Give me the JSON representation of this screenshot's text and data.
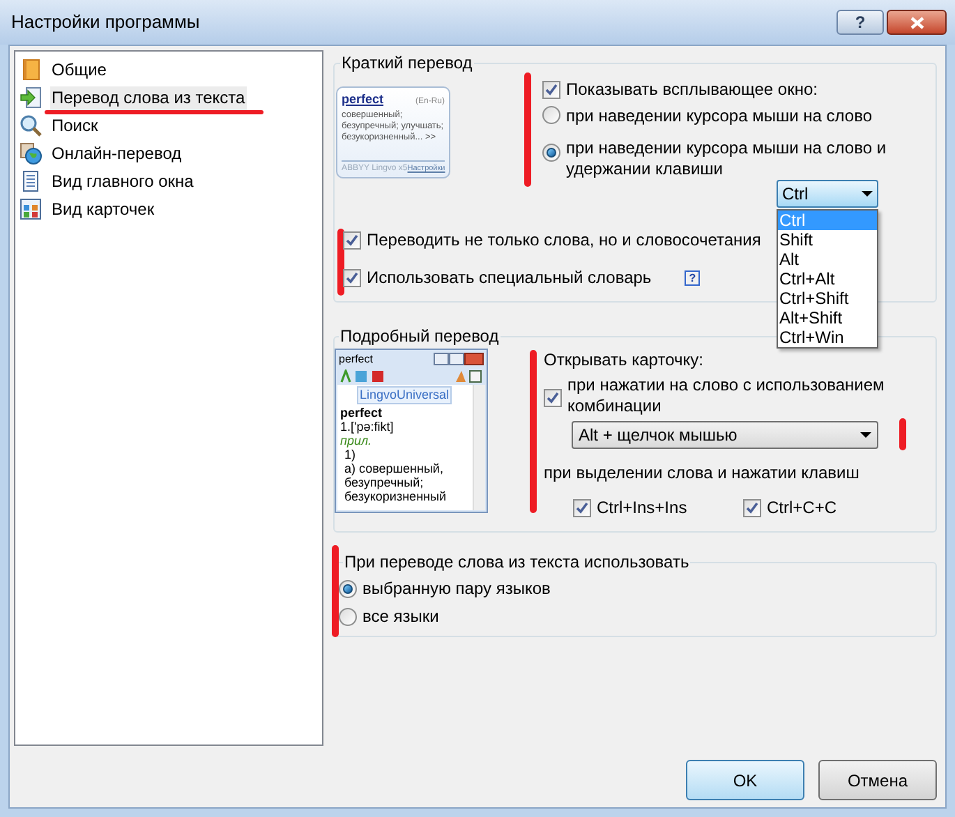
{
  "window": {
    "title": "Настройки программы",
    "help_button": "?"
  },
  "sidebar": {
    "items": [
      {
        "label": "Общие",
        "selected": false
      },
      {
        "label": "Перевод слова из текста",
        "selected": true
      },
      {
        "label": "Поиск",
        "selected": false
      },
      {
        "label": "Онлайн-перевод",
        "selected": false
      },
      {
        "label": "Вид главного окна",
        "selected": false
      },
      {
        "label": "Вид карточек",
        "selected": false
      }
    ]
  },
  "quick_translation": {
    "title": "Краткий перевод",
    "preview": {
      "word": "perfect",
      "langs": "(En-Ru)",
      "lines": [
        "совершенный;",
        "безупречный; улучшать;",
        "безукоризненный... >>"
      ],
      "brand": "ABBYY Lingvo x5",
      "settings_link": "Настройки"
    },
    "show_popup": {
      "label": "Показывать всплывающее окно:",
      "checked": true
    },
    "modes": [
      {
        "label": "при наведении курсора мыши на слово",
        "selected": false
      },
      {
        "label": "при наведении курсора мыши на слово и удержании клавиши",
        "selected": true
      }
    ],
    "key_combo": {
      "value": "Ctrl",
      "expanded": true,
      "options": [
        {
          "label": "Ctrl",
          "selected": true
        },
        {
          "label": "Shift",
          "selected": false
        },
        {
          "label": "Alt",
          "selected": false
        },
        {
          "label": "Ctrl+Alt",
          "selected": false
        },
        {
          "label": "Ctrl+Shift",
          "selected": false
        },
        {
          "label": "Alt+Shift",
          "selected": false
        },
        {
          "label": "Ctrl+Win",
          "selected": false
        }
      ]
    },
    "options": [
      {
        "label": "Переводить не только слова, но и словосочетания",
        "checked": true
      },
      {
        "label": "Использовать специальный словарь",
        "checked": true,
        "help": "?"
      }
    ]
  },
  "detailed_translation": {
    "title": "Подробный перевод",
    "card_preview": {
      "title": "perfect",
      "dictionary": "LingvoUniversal",
      "headword": "perfect",
      "entry": [
        {
          "text": "1.['pə:fikt]",
          "kind": "pron"
        },
        {
          "text": "прил.",
          "kind": "pos"
        },
        {
          "text": "1)",
          "kind": "sense"
        },
        {
          "text": "а) совершенный,",
          "kind": "gloss"
        },
        {
          "text": "безупречный;",
          "kind": "gloss"
        },
        {
          "text": "безукоризненный",
          "kind": "gloss"
        }
      ]
    },
    "open_card_label": "Открывать карточку:",
    "click_option": {
      "label": "при нажатии на слово с использованием комбинации",
      "checked": true
    },
    "click_combo": {
      "value": "Alt + щелчок мышью"
    },
    "select_label": "при выделении слова и нажатии клавиш",
    "key_options": [
      {
        "label": "Ctrl+Ins+Ins",
        "checked": true
      },
      {
        "label": "Ctrl+C+C",
        "checked": true
      }
    ]
  },
  "language_scope": {
    "title": "При переводе слова из текста использовать",
    "options": [
      {
        "label": "выбранную пару языков",
        "selected": true
      },
      {
        "label": "все языки",
        "selected": false
      }
    ]
  },
  "buttons": [
    {
      "label": "OK",
      "default": true
    },
    {
      "label": "Отмена",
      "default": false
    }
  ]
}
